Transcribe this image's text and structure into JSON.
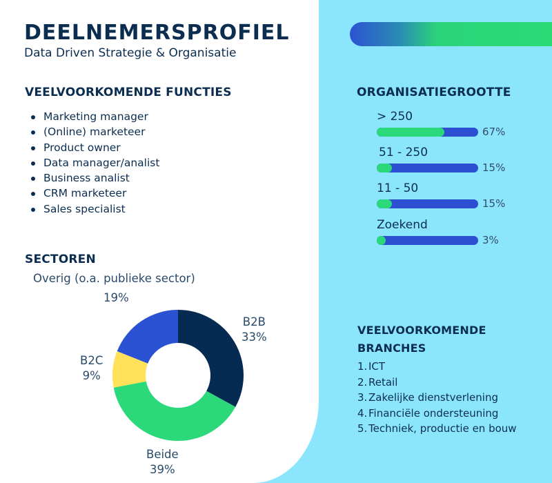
{
  "header": {
    "title": "DEELNEMERSPROFIEL",
    "subtitle": "Data Driven Strategie & Organisatie"
  },
  "functies": {
    "heading": "VEELVOORKOMENDE FUNCTIES",
    "items": [
      "Marketing manager",
      "(Online) marketeer",
      "Product owner",
      "Data manager/analist",
      "Business analist",
      "CRM marketeer",
      "Sales specialist"
    ]
  },
  "colors": {
    "navy": "#0b2d50",
    "green": "#2bd87a",
    "blue": "#2c4fd2",
    "yellow": "#ffe15a",
    "light_blue_bg": "#8be6fd"
  },
  "chart_data": [
    {
      "type": "pie",
      "variant": "donut",
      "title": "SECTOREN",
      "categories": [
        "B2B",
        "Beide",
        "B2C",
        "Overig (o.a. publieke sector)"
      ],
      "values": [
        33,
        39,
        9,
        19
      ],
      "unit": "%",
      "colors": [
        "#062b52",
        "#2bd87a",
        "#ffe15a",
        "#2c52d4"
      ],
      "labels": [
        {
          "name": "B2B",
          "pct": "33%"
        },
        {
          "name": "Beide",
          "pct": "39%"
        },
        {
          "name": "B2C",
          "pct": "9%"
        },
        {
          "name": "Overig (o.a. publieke sector)",
          "pct": "19%"
        }
      ],
      "start": "12 o'clock, clockwise"
    },
    {
      "type": "bar",
      "orientation": "horizontal",
      "title": "ORGANISATIEGROOTTE",
      "categories": [
        "> 250",
        "51 - 250",
        "11 - 50",
        "Zoekend"
      ],
      "values": [
        67,
        15,
        15,
        3
      ],
      "value_labels": [
        "67%",
        "15%",
        "15%",
        "3%"
      ],
      "unit": "%",
      "xlim": [
        0,
        100
      ]
    }
  ],
  "branches": {
    "heading_line1": "VEELVOORKOMENDE",
    "heading_line2": "BRANCHES",
    "items": [
      {
        "num": "1.",
        "label": "ICT"
      },
      {
        "num": "2.",
        "label": "Retail"
      },
      {
        "num": "3.",
        "label": "Zakelijke dienstverlening"
      },
      {
        "num": "4.",
        "label": "Financiële ondersteuning"
      },
      {
        "num": "5.",
        "label": "Techniek, productie en bouw"
      }
    ]
  }
}
